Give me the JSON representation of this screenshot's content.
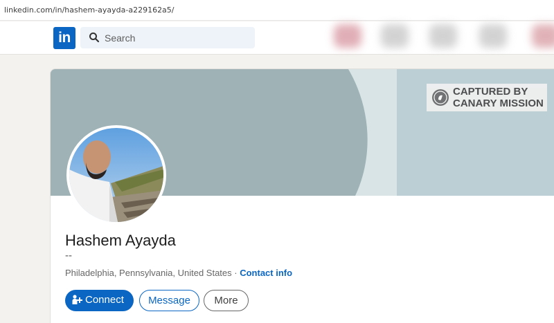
{
  "browser": {
    "url": "linkedin.com/in/hashem-ayayda-a229162a5/"
  },
  "nav": {
    "logo_text": "in",
    "search_placeholder": "Search"
  },
  "banner": {
    "watermark_line1": "CAPTURED BY",
    "watermark_line2": "CANARY MISSION"
  },
  "profile": {
    "name": "Hashem Ayayda",
    "headline": "--",
    "location": "Philadelphia, Pennsylvania, United States",
    "separator": " · ",
    "contact_label": "Contact info"
  },
  "actions": {
    "connect_label": "Connect",
    "message_label": "Message",
    "more_label": "More"
  },
  "colors": {
    "brand": "#0a66c2",
    "banner_dark": "#9fb2b6",
    "banner_light": "#b8cbd0"
  },
  "icons": [
    "search-icon",
    "person-plus-icon",
    "canary-bird-icon",
    "linkedin-logo"
  ]
}
